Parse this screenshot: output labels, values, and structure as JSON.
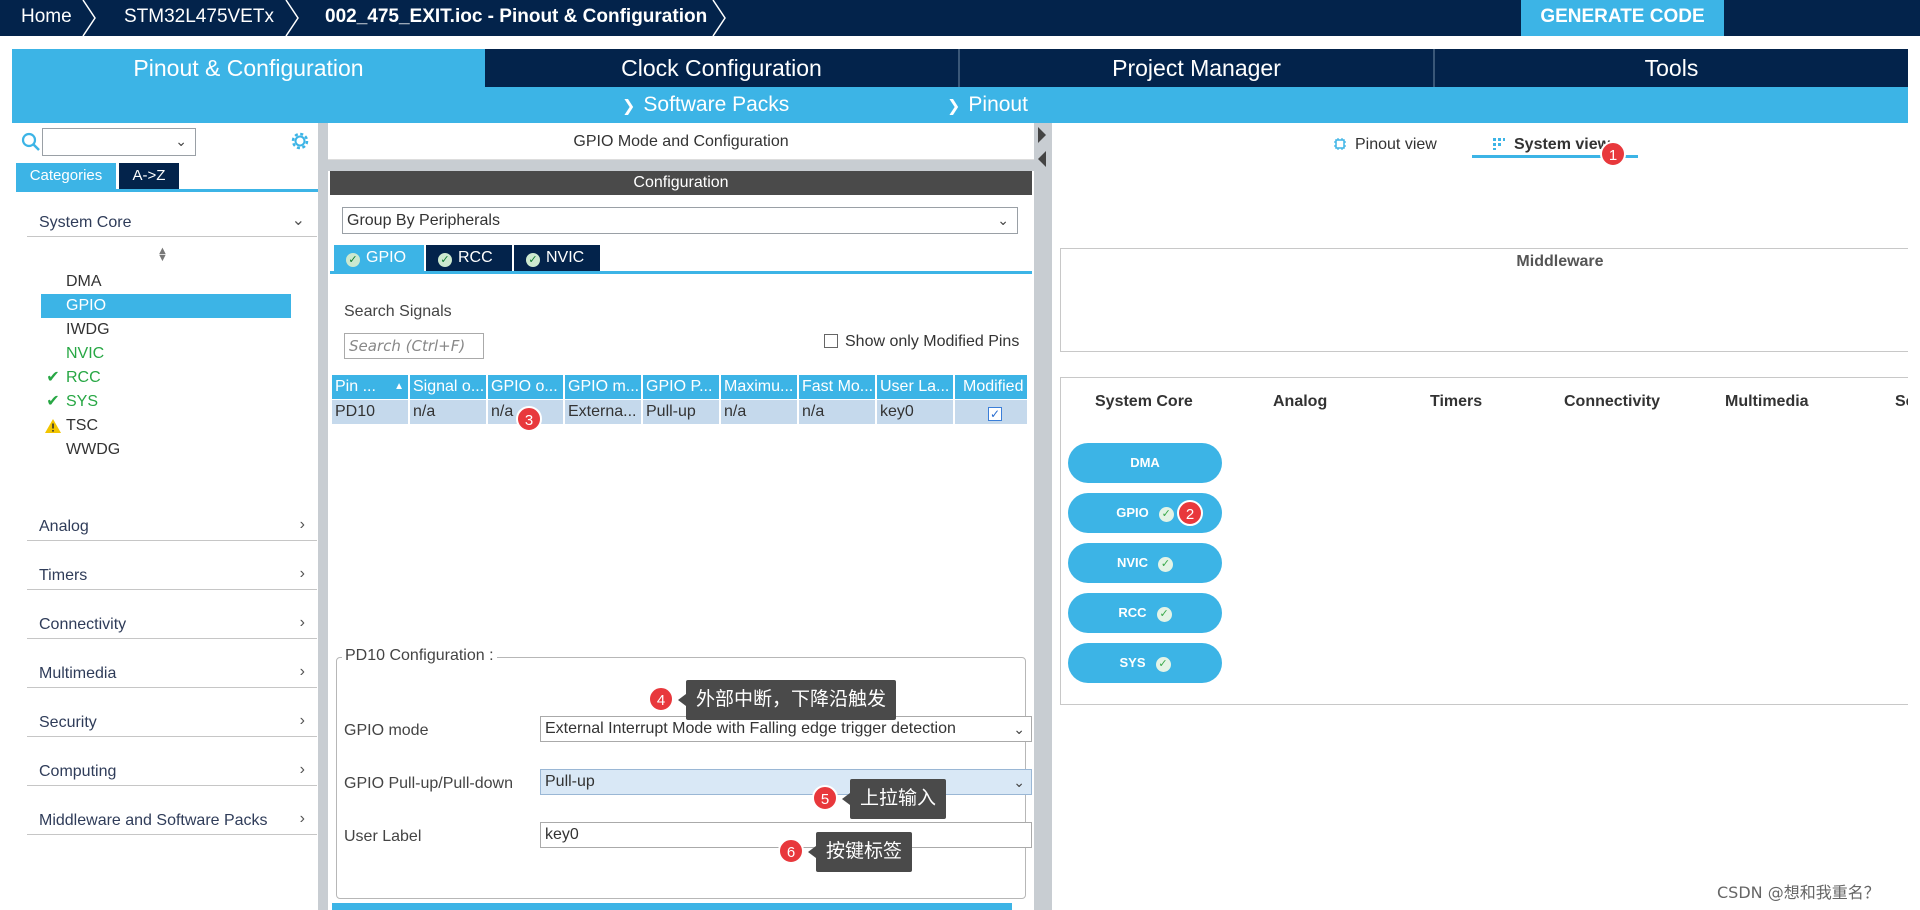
{
  "breadcrumb": {
    "home": "Home",
    "device": "STM32L475VETx",
    "file": "002_475_EXIT.ioc - Pinout & Configuration"
  },
  "generate_button": "GENERATE CODE",
  "main_tabs": [
    {
      "label": "Pinout & Configuration",
      "active": true
    },
    {
      "label": "Clock Configuration",
      "active": false
    },
    {
      "label": "Project Manager",
      "active": false
    },
    {
      "label": "Tools",
      "active": false
    }
  ],
  "sub_menu": {
    "software_packs": "Software Packs",
    "pinout": "Pinout"
  },
  "left_panel": {
    "search_value": "",
    "tabs": {
      "categories": "Categories",
      "atoz": "A->Z"
    },
    "system_core": {
      "label": "System Core",
      "sort_icon": "sort-icon",
      "items": [
        {
          "label": "DMA",
          "status": "none"
        },
        {
          "label": "GPIO",
          "status": "selected"
        },
        {
          "label": "IWDG",
          "status": "none"
        },
        {
          "label": "NVIC",
          "status": "green"
        },
        {
          "label": "RCC",
          "status": "check"
        },
        {
          "label": "SYS",
          "status": "check"
        },
        {
          "label": "TSC",
          "status": "warning"
        },
        {
          "label": "WWDG",
          "status": "none"
        }
      ]
    },
    "categories": [
      "Analog",
      "Timers",
      "Connectivity",
      "Multimedia",
      "Security",
      "Computing",
      "Middleware and Software Packs"
    ]
  },
  "middle_panel": {
    "title": "GPIO Mode and Configuration",
    "config_bar": "Configuration",
    "group_by": "Group By Peripherals",
    "peripheral_tabs": [
      "GPIO",
      "RCC",
      "NVIC"
    ],
    "search_label": "Search Signals",
    "search_placeholder": "Search (Ctrl+F)",
    "show_modified": "Show only Modified Pins",
    "table": {
      "headers": [
        "Pin ...",
        "Signal o...",
        "GPIO o...",
        "GPIO m...",
        "GPIO P...",
        "Maximu...",
        "Fast Mo...",
        "User La...",
        "Modified"
      ],
      "row": [
        "PD10",
        "n/a",
        "n/a",
        "Externa...",
        "Pull-up",
        "n/a",
        "n/a",
        "key0"
      ]
    },
    "pin_config": {
      "title": "PD10 Configuration :",
      "gpio_mode_label": "GPIO mode",
      "gpio_mode_value": "External Interrupt Mode with Falling edge trigger detection",
      "pull_label": "GPIO Pull-up/Pull-down",
      "pull_value": "Pull-up",
      "user_label_label": "User Label",
      "user_label_value": "key0"
    }
  },
  "right_panel": {
    "pinout_view": "Pinout view",
    "system_view": "System view",
    "middleware": "Middleware",
    "columns": [
      "System Core",
      "Analog",
      "Timers",
      "Connectivity",
      "Multimedia",
      "Se"
    ],
    "system_core_items": [
      "DMA",
      "GPIO",
      "NVIC",
      "RCC",
      "SYS"
    ]
  },
  "annotations": {
    "b1": "1",
    "b2": "2",
    "b3": "3",
    "b4": "4",
    "b5": "5",
    "b6": "6",
    "c4": "外部中断，下降沿触发",
    "c5": "上拉输入",
    "c6": "按键标签"
  },
  "watermark": "CSDN @想和我重名？",
  "colors": {
    "navy": "#03234b",
    "accent": "#3cb4e6",
    "badge": "#e8383c"
  }
}
